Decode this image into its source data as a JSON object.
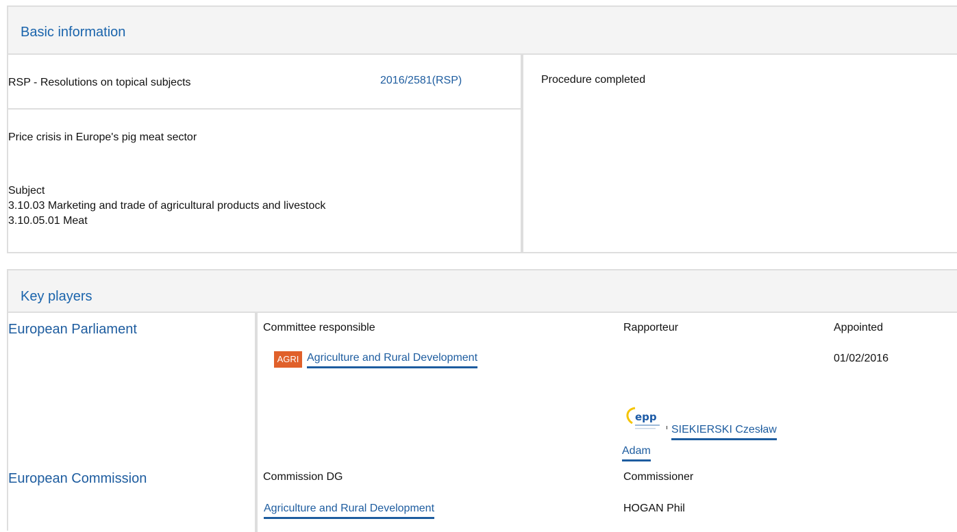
{
  "basic": {
    "title": "Basic information",
    "procedure_type": "RSP - Resolutions on topical subjects",
    "procedure_ref": "2016/2581(RSP)",
    "status": "Procedure completed",
    "procedure_title": "Price crisis in Europe's pig meat sector",
    "subject_label": "Subject",
    "subjects": [
      "3.10.03 Marketing and trade of agricultural products and livestock",
      "3.10.05.01 Meat"
    ]
  },
  "key_players": {
    "title": "Key players",
    "parliament": {
      "label": "European Parliament",
      "col_committee": "Committee responsible",
      "col_rapporteur": "Rapporteur",
      "col_appointed": "Appointed",
      "committee_badge": "AGRI",
      "committee_name": "Agriculture and Rural Development",
      "appointed_date": "01/02/2016",
      "group_logo_text": "epp",
      "rapporteur_line1": "SIEKIERSKI Czesław",
      "rapporteur_line2": "Adam"
    },
    "commission": {
      "label": "European Commission",
      "col_dg": "Commission DG",
      "col_commissioner": "Commissioner",
      "dg_name": "Agriculture and Rural Development",
      "commissioner_name": "HOGAN Phil"
    }
  },
  "colors": {
    "heading_blue": "#1a64ac",
    "link_blue": "#1d5c9f",
    "badge_orange": "#e0602a",
    "border_grey": "#dedede",
    "header_bg": "#f4f4f4"
  }
}
